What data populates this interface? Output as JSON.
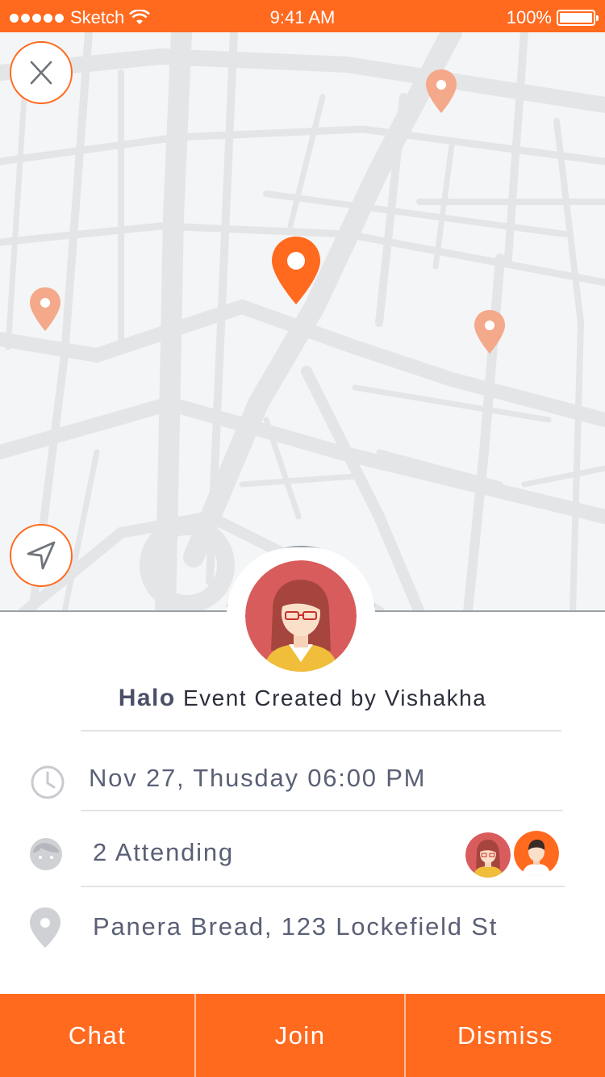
{
  "status_bar": {
    "carrier": "Sketch",
    "time": "9:41 AM",
    "battery": "100%"
  },
  "map": {
    "close_icon": "close-icon",
    "locate_icon": "navigation-arrow-icon",
    "pin_color_primary": "#ff6a1f",
    "pin_color_secondary": "#f4a98a"
  },
  "event": {
    "name": "Halo",
    "created_by_text": "Event Created by Vishakha",
    "datetime": "Nov 27, Thusday 06:00 PM",
    "attending": "2 Attending",
    "location": "Panera Bread, 123 Lockefield St"
  },
  "actions": {
    "chat_label": "Chat",
    "join_label": "Join",
    "dismiss_label": "Dismiss"
  },
  "colors": {
    "accent": "#ff6a1f",
    "text": "#5a6075",
    "map_bg": "#f4f5f6",
    "road": "#e4e5e7"
  }
}
